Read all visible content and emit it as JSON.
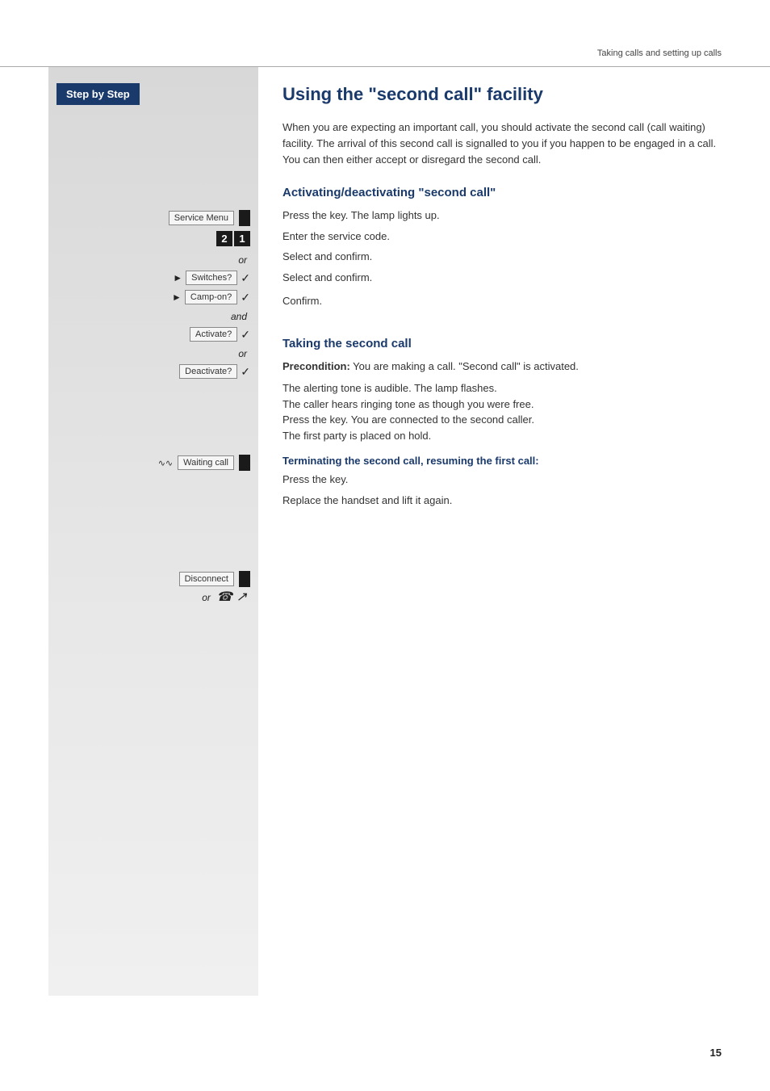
{
  "header": {
    "title": "Taking calls and setting up calls"
  },
  "sidebar": {
    "label": "Step by Step",
    "service_menu_label": "Service Menu",
    "code_digits": [
      "2",
      "1"
    ],
    "or1": "or",
    "switches_label": "Switches?",
    "campon_label": "Camp-on?",
    "and": "and",
    "activate_label": "Activate?",
    "or2": "or",
    "deactivate_label": "Deactivate?",
    "waiting_call_label": "Waiting call",
    "disconnect_label": "Disconnect",
    "or3": "or"
  },
  "main": {
    "title": "Using the \"second call\" facility",
    "intro": "When you are expecting an important call, you should activate the second call (call waiting) facility. The arrival of this second call is signalled to you if you happen to be engaged in a call. You can then either accept or disregard the second call.",
    "section1_heading": "Activating/deactivating \"second call\"",
    "step1": "Press the key. The lamp lights up.",
    "step2": "Enter the service code.",
    "step3": "Select and confirm.",
    "step4": "Select and confirm.",
    "step5": "Confirm.",
    "section2_heading": "Taking the second call",
    "precondition_bold": "Precondition:",
    "precondition_text": " You are making a call. \"Second call\" is activated.",
    "step6": "The alerting tone is audible. The lamp flashes.\nThe caller hears ringing tone as though you were free.\nPress the key. You are connected to the second caller.\nThe first party is placed on hold.",
    "subheading": "Terminating the second call, resuming the first call:",
    "step7": "Press the key.",
    "step8": "Replace the handset and lift it again."
  },
  "page_number": "15"
}
